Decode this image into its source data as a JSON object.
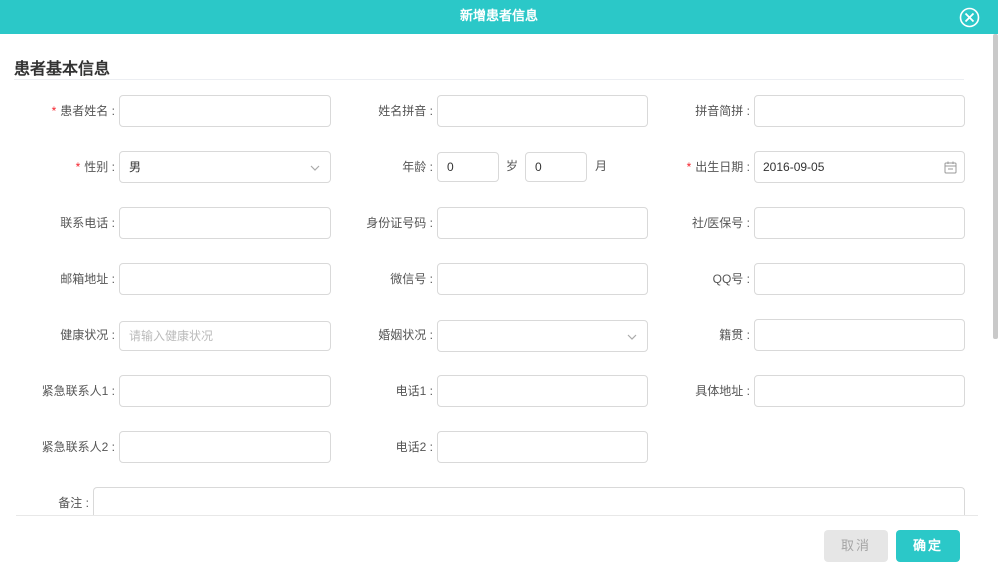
{
  "dialog": {
    "title": "新增患者信息"
  },
  "section": {
    "title": "患者基本信息"
  },
  "colors": {
    "accent": "#2bc8c8",
    "required": "#f5222d"
  },
  "fields": {
    "name": {
      "label": "患者姓名",
      "value": "",
      "required": true
    },
    "pinyin": {
      "label": "姓名拼音",
      "value": ""
    },
    "pinyin_short": {
      "label": "拼音简拼",
      "value": ""
    },
    "gender": {
      "label": "性别",
      "value": "男",
      "required": true
    },
    "age": {
      "label": "年龄",
      "years": "0",
      "years_unit": "岁",
      "months": "0",
      "months_unit": "月"
    },
    "birth_date": {
      "label": "出生日期",
      "value": "2016-09-05",
      "required": true
    },
    "phone": {
      "label": "联系电话",
      "value": ""
    },
    "id_number": {
      "label": "身份证号码",
      "value": ""
    },
    "social_security": {
      "label": "社/医保号",
      "value": ""
    },
    "email": {
      "label": "邮箱地址",
      "value": ""
    },
    "wechat": {
      "label": "微信号",
      "value": ""
    },
    "qq": {
      "label": "QQ号",
      "value": ""
    },
    "health": {
      "label": "健康状况",
      "value": "",
      "placeholder": "请输入健康状况"
    },
    "marital": {
      "label": "婚姻状况",
      "value": ""
    },
    "native_place": {
      "label": "籍贯",
      "value": ""
    },
    "emergency1": {
      "label": "紧急联系人1",
      "value": ""
    },
    "phone1": {
      "label": "电话1",
      "value": ""
    },
    "address": {
      "label": "具体地址",
      "value": ""
    },
    "emergency2": {
      "label": "紧急联系人2",
      "value": ""
    },
    "phone2": {
      "label": "电话2",
      "value": ""
    },
    "remark": {
      "label": "备注",
      "value": ""
    }
  },
  "label_separator": ":",
  "buttons": {
    "cancel": "取消",
    "ok": "确定"
  }
}
